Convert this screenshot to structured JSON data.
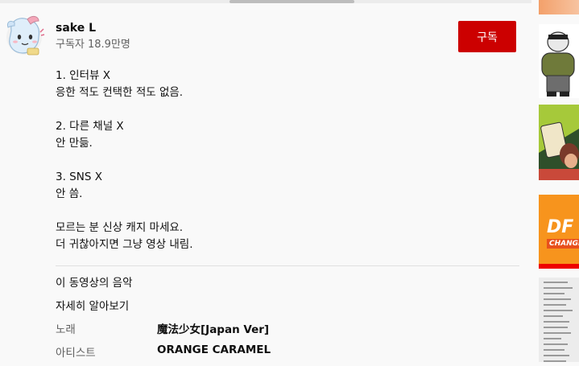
{
  "channel": {
    "name": "sake L",
    "subscribers": "구독자 18.9만명",
    "subscribe_label": "구독"
  },
  "description": {
    "lines": [
      "1. 인터뷰 X",
      "응한 적도 컨택한 적도 없음.",
      "",
      "2. 다른 채널 X",
      "안 만듦.",
      "",
      "3. SNS X",
      "안 씀.",
      "",
      "모르는 분 신상 캐지 마세요.",
      "더 귀찮아지면 그냥 영상 내림."
    ]
  },
  "music": {
    "section_title": "이 동영상의 음악",
    "learn_more": "자세히 알아보기",
    "song_label": "노래",
    "song_value": "魔法少女[Japan Ver]",
    "artist_label": "아티스트",
    "artist_value": "ORANGE CARAMEL"
  },
  "thumbnails": {
    "df_text": "DF",
    "df_subtext": "CHANGI"
  },
  "colors": {
    "subscribe_bg": "#cc0000",
    "secondary_text": "#606060"
  }
}
